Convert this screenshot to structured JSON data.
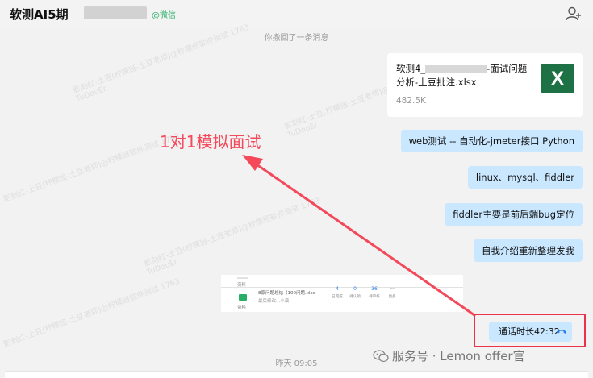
{
  "header": {
    "title": "软测AI5期",
    "tag": "@微信"
  },
  "messages": {
    "system_recalled": "你撤回了一条消息",
    "file": {
      "name_prefix": "软测4_",
      "name_suffix": "-面试问题分析-土豆批注.xlsx",
      "size": "482.5K",
      "icon_letter": "X"
    },
    "bubbles": [
      "web测试 -- 自动化-jmeter接口 Python",
      "linux、mysql、fiddler",
      "fiddler主要是前后端bug定位",
      "自我介绍重新整理发我"
    ],
    "call_duration": "通话时长42:32",
    "timestamp": "昨天 09:05"
  },
  "preview": {
    "file_title": "8家问题总结（100问题.xlsx",
    "file_meta": "最后修改...小演",
    "stats": [
      {
        "value": "4",
        "label": "已完成"
      },
      {
        "value": "0",
        "label": "待认领"
      },
      {
        "value": "36",
        "label": "待审核"
      },
      {
        "value": "···",
        "label": "更多"
      }
    ],
    "row_label_1": "资料",
    "row_label_2": "资料"
  },
  "annotation": "1对1模拟面试",
  "watermark": "影刻红-土豆(柠檬班-土豆老师)@柠檬班软件测试 1763",
  "watermark_sub": "TuDouEr",
  "footer": {
    "brand": "服务号 · Lemon offer官"
  },
  "colors": {
    "bubble": "#c9e7ff",
    "annotation": "#f4485b",
    "excel": "#1e7145",
    "wechat_green": "#2aae67"
  }
}
